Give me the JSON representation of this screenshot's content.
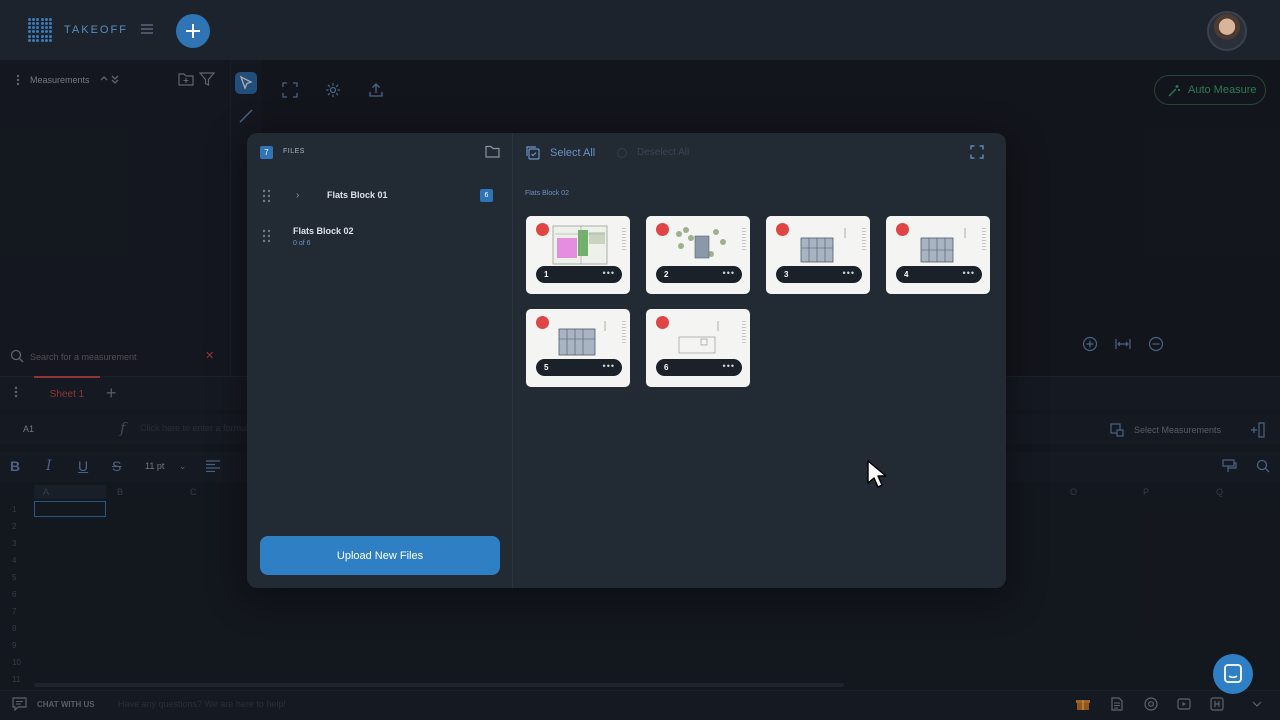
{
  "app": {
    "name": "TAKEOFF"
  },
  "left_panel": {
    "title": "Measurements",
    "search_placeholder": "Search for a measurement"
  },
  "canvas": {
    "auto_measure_label": "Auto Measure"
  },
  "sheets": {
    "tabs": [
      "Sheet 1"
    ],
    "cell_ref": "A1",
    "formula_placeholder": "Click here to enter a formula",
    "select_measurements_label": "Select Measurements",
    "font_size": "11 pt"
  },
  "grid": {
    "columns": [
      "A",
      "B",
      "C",
      "O",
      "P",
      "Q"
    ],
    "rows": [
      "1",
      "2",
      "3",
      "4",
      "5",
      "6",
      "7",
      "8",
      "9",
      "10",
      "11"
    ]
  },
  "files_modal": {
    "count": "7",
    "header": "FILES",
    "select_all": "Select All",
    "deselect_all": "Deselect All",
    "folders": [
      {
        "name": "Flats Block 01",
        "badge": "6"
      },
      {
        "name": "Flats Block 02",
        "sub": "0 of 6"
      }
    ],
    "current_folder": "Flats Block 02",
    "pages": [
      {
        "number": "1",
        "more": "•••"
      },
      {
        "number": "2",
        "more": "•••"
      },
      {
        "number": "3",
        "more": "•••"
      },
      {
        "number": "4",
        "more": "•••"
      },
      {
        "number": "5",
        "more": "•••"
      },
      {
        "number": "6",
        "more": "•••"
      }
    ],
    "upload_label": "Upload New Files"
  },
  "chat": {
    "label": "CHAT WITH US",
    "placeholder": "Have any questions? We are here to help!"
  },
  "colors": {
    "accent": "#2f74b5",
    "danger": "#e04545",
    "success": "#3cb878"
  }
}
